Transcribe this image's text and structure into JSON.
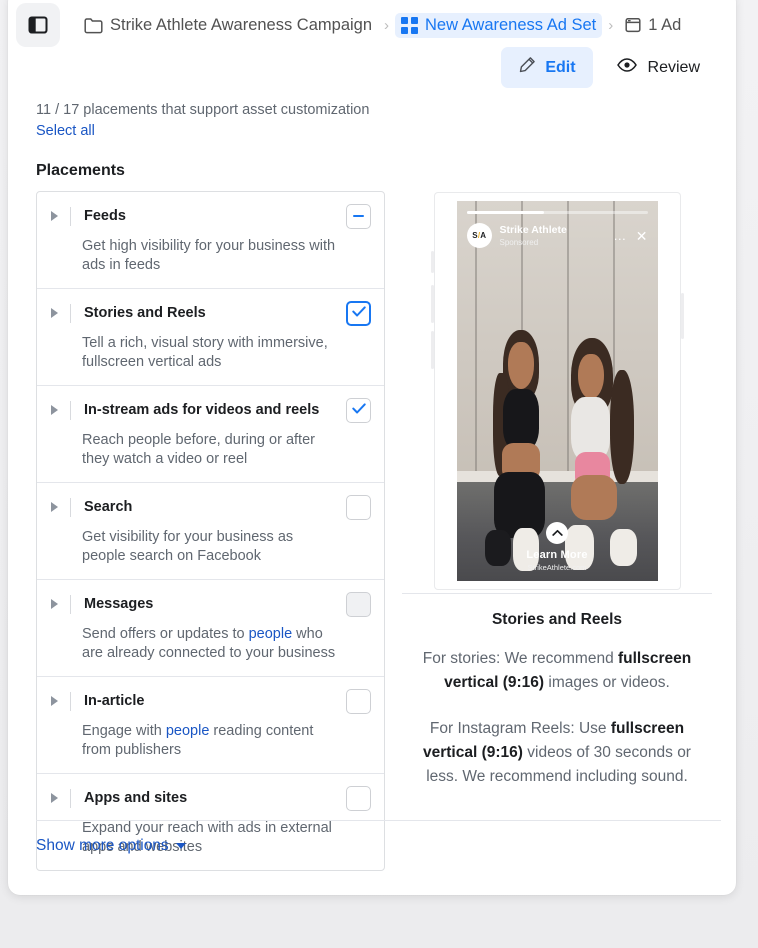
{
  "window": {
    "panel_toggle_icon": "sidebar-panel-icon"
  },
  "breadcrumb": {
    "items": [
      {
        "label": "Strike Athlete Awareness Campaign",
        "icon": "folder-icon",
        "active": false
      },
      {
        "label": "New Awareness Ad Set",
        "icon": "grid-icon",
        "active": true
      },
      {
        "label": "1 Ad",
        "icon": "window-icon",
        "active": false
      }
    ],
    "separator": "›"
  },
  "actions": {
    "edit_label": "Edit",
    "edit_icon": "pencil-icon",
    "review_label": "Review",
    "review_icon": "eye-icon"
  },
  "placements_panel": {
    "count_line": "11 / 17 placements that support asset customization",
    "select_all_label": "Select all",
    "section_title": "Placements",
    "items": [
      {
        "title": "Feeds",
        "description": "Get high visibility for your business with ads in feeds",
        "state": "indeterminate"
      },
      {
        "title": "Stories and Reels",
        "description": "Tell a rich, visual story with immersive, fullscreen vertical ads",
        "state": "checked-focused"
      },
      {
        "title": "In-stream ads for videos and reels",
        "description": "Reach people before, during or after they watch a video or reel",
        "state": "checked"
      },
      {
        "title": "Search",
        "description": "Get visibility for your business as people search on Facebook",
        "state": "unchecked"
      },
      {
        "title": "Messages",
        "description_pre": "Send offers or updates to ",
        "description_link": "people",
        "description_post": " who are already connected to your business",
        "state": "unchecked-hovered"
      },
      {
        "title": "In-article",
        "description_pre": "Engage with ",
        "description_link": "people",
        "description_post": " reading content from publishers",
        "state": "unchecked"
      },
      {
        "title": "Apps and sites",
        "description": "Expand your reach with ads in external apps and websites",
        "state": "unchecked"
      }
    ]
  },
  "preview": {
    "story": {
      "avatar_initials_left": "S",
      "avatar_initials_slash": "/",
      "avatar_initials_right": "A",
      "brand_name": "Strike Athlete",
      "sponsored_label": "Sponsored",
      "more_icon": "more-dots-icon",
      "close_icon": "close-icon",
      "cta_icon": "chevron-up-icon",
      "cta_label": "Learn More",
      "cta_url": "StrikeAthlete.com"
    },
    "title": "Stories and Reels",
    "paragraph_one": {
      "a": "For stories: We recommend ",
      "b": "fullscreen vertical (9:16)",
      "c": " images or videos."
    },
    "paragraph_two": {
      "a": "For Instagram Reels: Use ",
      "b": "fullscreen vertical (9:16)",
      "c": " videos of 30 seconds or less. We recommend including sound."
    }
  },
  "footer": {
    "show_more_label": "Show more options",
    "caret_icon": "caret-down-icon"
  },
  "colors": {
    "accent_blue": "#1877f2",
    "link_blue": "#1a56c4",
    "edit_bg": "#e7f0fe",
    "text_primary": "#1c1e21",
    "text_secondary": "#606770",
    "border": "#dddfe2"
  }
}
